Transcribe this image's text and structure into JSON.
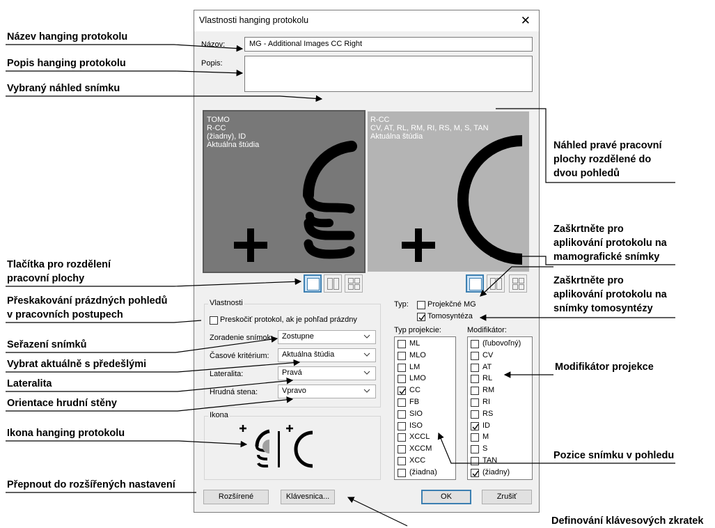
{
  "annotations": {
    "name": "Název hanging protokolu",
    "description": "Popis hanging protokolu",
    "selected_preview": "Vybraný náhled snímku",
    "right_preview": [
      "Náhled pravé pracovní",
      "plochy rozdělené do",
      "dvou pohledů"
    ],
    "mg_check": [
      "Zaškrtněte pro",
      "aplikování protokolu na",
      "mamografické snímky"
    ],
    "tomo_check": [
      "Zaškrtněte pro",
      "aplikování protokolu na",
      "snímky tomosyntézy"
    ],
    "split_buttons": [
      "Tlačítka pro rozdělení",
      "pracovní plochy"
    ],
    "skip_empty": [
      "Přeskakování prázdných  pohledů",
      "v pracovních postupech"
    ],
    "sorting": "Seřazení snímků",
    "current_prior": "Vybrat aktuálně s předešlými",
    "laterality": "Lateralita",
    "chest_wall": "Orientace hrudní stěny",
    "icon": "Ikona hanging protokolu",
    "modifier": "Modifikátor projekce",
    "position": "Pozice snímku v pohledu",
    "advanced": "Přepnout do rozšířených nastavení",
    "shortcuts": "Definování klávesových zkratek"
  },
  "dialog": {
    "title": "Vlastnosti hanging protokolu",
    "name_label": "Názov:",
    "name_value": "MG - Additional Images CC Right",
    "description_label": "Popis:",
    "description_value": "",
    "left_pane_lines": [
      "TOMO",
      "R-CC",
      "(žiadny), ID",
      "Aktuálna štúdia"
    ],
    "right_pane_lines": [
      "R-CC",
      "CV, AT, RL, RM, RI, RS, M, S, TAN",
      "Aktuálna štúdia"
    ],
    "properties_legend": "Vlastnosti",
    "skip_label": "Preskočiť protokol, ak je pohľad prázdny",
    "sort_label": "Zoradenie snímok:",
    "sort_value": "Zostupne",
    "time_label": "Časové kritérium:",
    "time_value": "Aktuálna štúdia",
    "laterality_label": "Lateralita:",
    "laterality_value": "Pravá",
    "chest_label": "Hrudná stena:",
    "chest_value": "Vpravo",
    "icon_legend": "Ikona",
    "type_label": "Typ:",
    "proj_mg_label": "Projekčné MG",
    "proj_mg_checked": false,
    "tomo_label": "Tomosyntéza",
    "tomo_checked": true,
    "proj_type_label": "Typ projekcie:",
    "modifier_label": "Modifikátor:",
    "projections": [
      {
        "label": "ML",
        "checked": false
      },
      {
        "label": "MLO",
        "checked": false
      },
      {
        "label": "LM",
        "checked": false
      },
      {
        "label": "LMO",
        "checked": false
      },
      {
        "label": "CC",
        "checked": true
      },
      {
        "label": "FB",
        "checked": false
      },
      {
        "label": "SIO",
        "checked": false
      },
      {
        "label": "ISO",
        "checked": false
      },
      {
        "label": "XCCL",
        "checked": false
      },
      {
        "label": "XCCM",
        "checked": false
      },
      {
        "label": "XCC",
        "checked": false
      },
      {
        "label": "(žiadna)",
        "checked": false
      }
    ],
    "modifiers": [
      {
        "label": "(ľubovoľný)",
        "checked": false
      },
      {
        "label": "CV",
        "checked": false
      },
      {
        "label": "AT",
        "checked": false
      },
      {
        "label": "RL",
        "checked": false
      },
      {
        "label": "RM",
        "checked": false
      },
      {
        "label": "RI",
        "checked": false
      },
      {
        "label": "RS",
        "checked": false
      },
      {
        "label": "ID",
        "checked": true
      },
      {
        "label": "M",
        "checked": false
      },
      {
        "label": "S",
        "checked": false
      },
      {
        "label": "TAN",
        "checked": false
      },
      {
        "label": "(žiadny)",
        "checked": true
      }
    ],
    "advanced_button": "Rozšírené",
    "keyboard_button": "Klávesnica...",
    "ok_button": "OK",
    "cancel_button": "Zrušiť"
  },
  "colors": {
    "left_pane": "#787878",
    "right_pane": "#b4b4b4",
    "accent": "#3c7fb1"
  }
}
